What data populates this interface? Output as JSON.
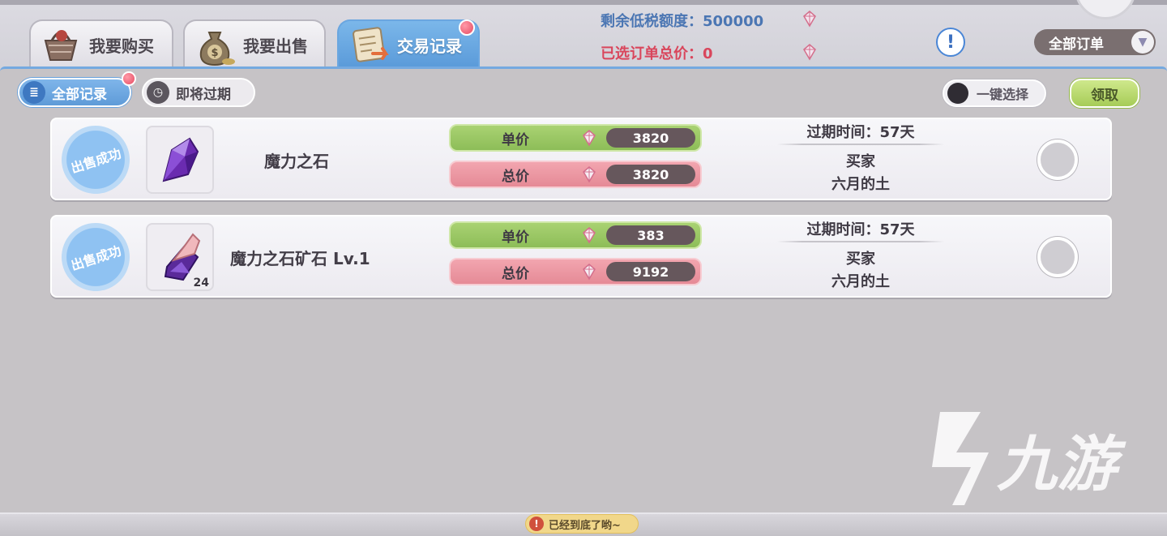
{
  "tabs": [
    {
      "label": "我要购买",
      "icon": "shopping-basket-icon"
    },
    {
      "label": "我要出售",
      "icon": "money-bag-icon"
    },
    {
      "label": "交易记录",
      "icon": "scroll-icon",
      "active": true
    }
  ],
  "header": {
    "tax_quota_label": "剩余低税额度：",
    "tax_quota_value": "500000",
    "selected_total_label": "已选订单总价：",
    "selected_total_value": "0",
    "help_glyph": "!",
    "filter_selected": "全部订单"
  },
  "subtabs": [
    {
      "label": "全部记录",
      "active": true
    },
    {
      "label": "即将过期",
      "active": false
    }
  ],
  "actions": {
    "select_all_label": "一键选择",
    "claim_label": "领取"
  },
  "records": [
    {
      "stamp": "出售成功",
      "item_name": "魔力之石",
      "quantity": "",
      "unit_price_label": "单价",
      "unit_price": "3820",
      "total_price_label": "总价",
      "total_price": "3820",
      "expire_text": "过期时间：57天",
      "buyer_label": "买家",
      "buyer_name": "六月的土"
    },
    {
      "stamp": "出售成功",
      "item_name": "魔力之石矿石 Lv.1",
      "quantity": "24",
      "unit_price_label": "单价",
      "unit_price": "383",
      "total_price_label": "总价",
      "total_price": "9192",
      "expire_text": "过期时间：57天",
      "buyer_label": "买家",
      "buyer_name": "六月的土"
    }
  ],
  "footer": {
    "end_of_list": "已经到底了哟~"
  },
  "watermark": {
    "text": "九游"
  },
  "colors": {
    "accent_blue": "#5a9ad9",
    "quota_blue": "#4b76b3",
    "total_red": "#d9465c",
    "unit_green": "#8dbd58",
    "total_pink": "#e58a96"
  }
}
